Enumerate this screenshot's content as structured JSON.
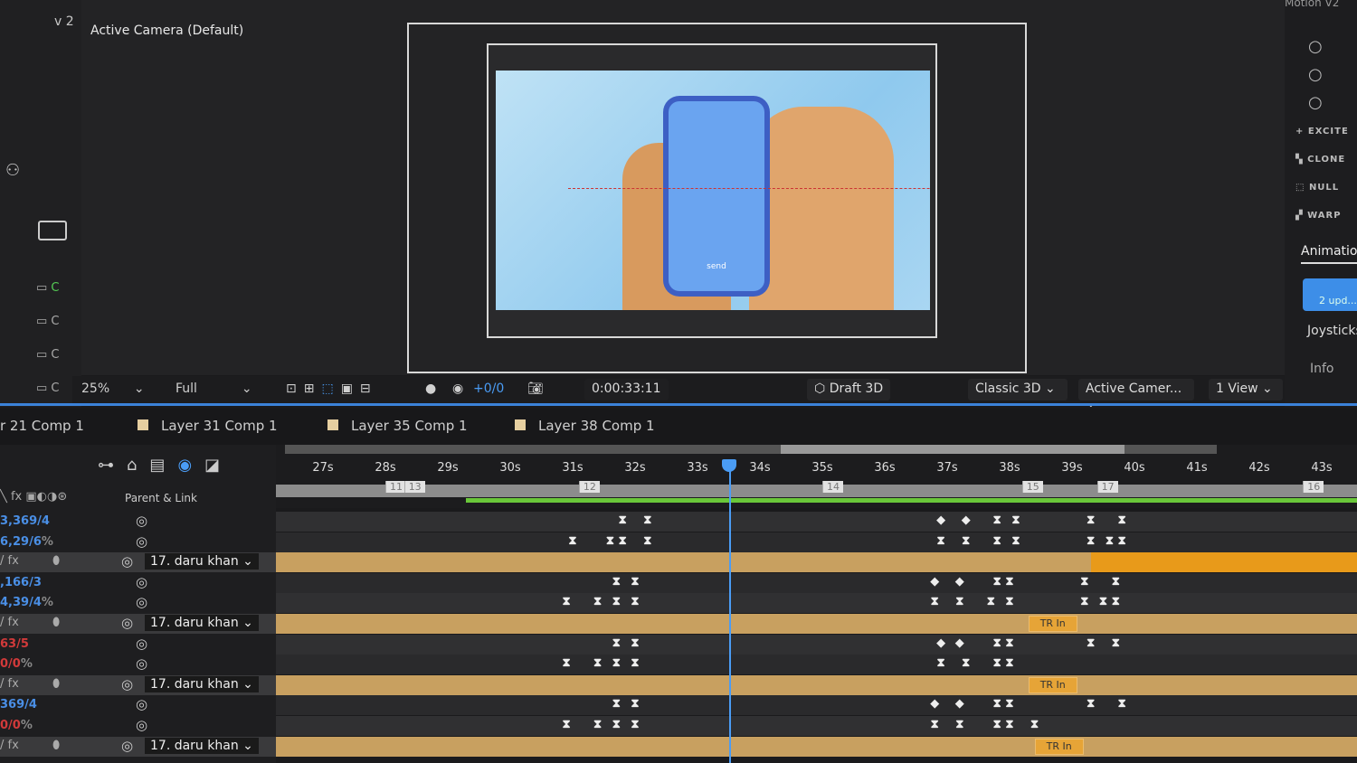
{
  "viewer": {
    "view_label": "v 2",
    "camera_label": "Active Camera (Default)",
    "phone_button": "send"
  },
  "toolbar": {
    "zoom": "25%",
    "resolution": "Full",
    "exposure": "+0/0",
    "timecode": "0:00:33:11",
    "draft3d": "Draft 3D",
    "renderer": "Classic 3D",
    "camera": "Active Camer...",
    "views": "1 View"
  },
  "right_panel": {
    "title": "Motion V2",
    "buttons": [
      "EXCITE",
      "CLONE",
      "NULL",
      "WARP"
    ],
    "tab": "Animation",
    "update_button": "2 upd...",
    "item": "Joysticks_",
    "info": "Info"
  },
  "timeline": {
    "tabs": [
      "r 21 Comp 1",
      "Layer 31 Comp 1",
      "Layer 35 Comp 1",
      "Layer 38 Comp 1"
    ],
    "column_header": "Parent & Link",
    "ticks": [
      "27s",
      "28s",
      "29s",
      "30s",
      "31s",
      "32s",
      "33s",
      "34s",
      "35s",
      "36s",
      "37s",
      "38s",
      "39s",
      "40s",
      "41s",
      "42s",
      "43s"
    ],
    "markers": [
      {
        "label": "11",
        "t": 28.0
      },
      {
        "label": "13",
        "t": 28.3
      },
      {
        "label": "12",
        "t": 31.1
      },
      {
        "label": "14",
        "t": 35.0
      },
      {
        "label": "15",
        "t": 38.2
      },
      {
        "label": "17",
        "t": 39.4
      },
      {
        "label": "16",
        "t": 42.7
      }
    ],
    "playhead_time": "0:00:33:11",
    "rows": [
      {
        "type": "prop",
        "value": "3,369/4",
        "unit": "",
        "color": "#4a8fe6",
        "keys": [
          31.8,
          32.2,
          36.9,
          37.3,
          37.8,
          38.1,
          39.3,
          39.8
        ],
        "diamonds": [
          36.9,
          37.3
        ]
      },
      {
        "type": "prop",
        "value": "6,29/6",
        "unit": "%",
        "color": "#4a8fe6",
        "keys": [
          31.0,
          31.6,
          31.8,
          32.2,
          36.9,
          37.3,
          37.8,
          38.1,
          39.3,
          39.6,
          39.8
        ],
        "diamonds": []
      },
      {
        "type": "layer",
        "parent": "17. daru khan",
        "highlight_from": 39.3
      },
      {
        "type": "prop",
        "value": ",166/3",
        "unit": "",
        "color": "#4a8fe6",
        "keys": [
          31.7,
          32.0,
          36.8,
          37.2,
          37.8,
          38.0,
          39.2,
          39.7
        ],
        "diamonds": [
          36.8,
          37.2
        ]
      },
      {
        "type": "prop",
        "value": "4,39/4",
        "unit": "%",
        "color": "#4a8fe6",
        "keys": [
          30.9,
          31.4,
          31.7,
          32.0,
          36.8,
          37.2,
          37.7,
          38.0,
          39.2,
          39.5,
          39.7
        ],
        "diamonds": []
      },
      {
        "type": "layer",
        "parent": "17. daru khan",
        "trin": "TR In",
        "trin_t": 38.3
      },
      {
        "type": "prop",
        "value": "63/5",
        "unit": "",
        "color": "#d23a3a",
        "keys": [
          31.7,
          32.0,
          36.9,
          37.2,
          37.8,
          38.0,
          39.3,
          39.7
        ],
        "diamonds": [
          36.9,
          37.2
        ]
      },
      {
        "type": "prop",
        "value": "0/0",
        "unit": "%",
        "color": "#d23a3a",
        "keys": [
          30.9,
          31.4,
          31.7,
          32.0,
          36.9,
          37.3,
          37.8,
          38.0
        ],
        "diamonds": []
      },
      {
        "type": "layer",
        "parent": "17. daru khan",
        "trin": "TR In",
        "trin_t": 38.3
      },
      {
        "type": "prop",
        "value": "369/4",
        "unit": "",
        "color": "#4a8fe6",
        "keys": [
          31.7,
          32.0,
          36.8,
          37.2,
          37.8,
          38.0,
          39.3,
          39.8
        ],
        "diamonds": [
          36.8,
          37.2
        ]
      },
      {
        "type": "prop",
        "value": "0/0",
        "unit": "%",
        "color": "#d23a3a",
        "keys": [
          30.9,
          31.4,
          31.7,
          32.0,
          36.8,
          37.2,
          37.8,
          38.0,
          38.4
        ],
        "diamonds": []
      },
      {
        "type": "layer",
        "parent": "17. daru khan",
        "trin": "TR In",
        "trin_t": 38.4
      }
    ]
  },
  "colors": {
    "accent": "#3b82d9",
    "layer_bar": "#c8a060",
    "layer_bar_active": "#e89a1a",
    "work_area": "#6ac73a"
  }
}
